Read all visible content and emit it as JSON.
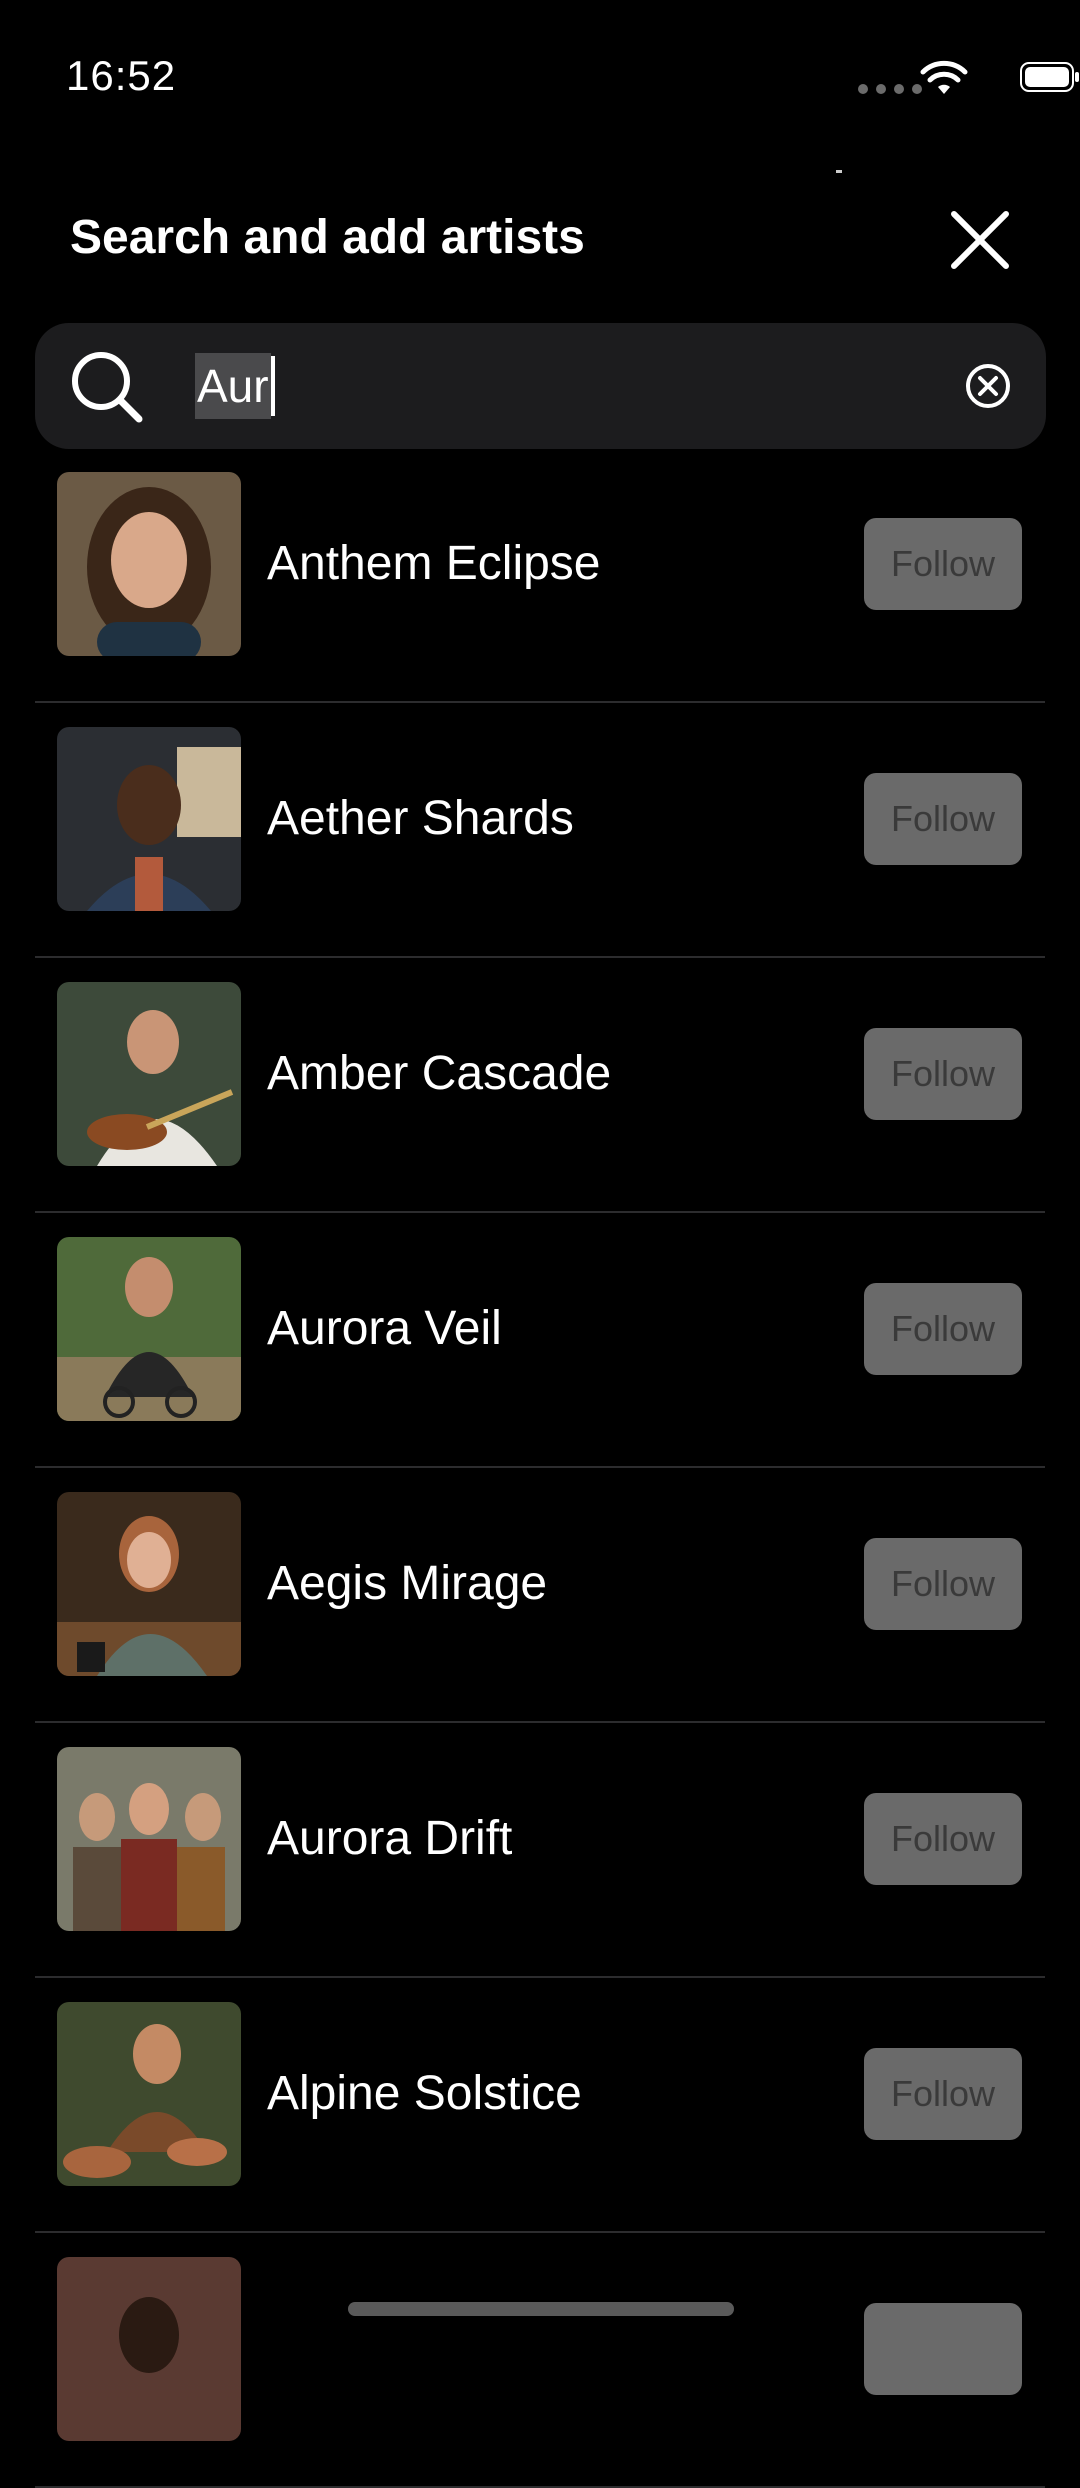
{
  "status_bar": {
    "time": "16:52",
    "wifi_icon": "wifi-icon",
    "battery_icon": "battery-icon"
  },
  "header": {
    "title": "Search and add artists",
    "close_icon": "close-icon"
  },
  "search": {
    "query": "Aur",
    "search_icon": "search-icon",
    "clear_icon": "clear-circle-icon"
  },
  "colors": {
    "background": "#000000",
    "search_background": "#1c1c1e",
    "follow_button_bg": "#6a6a6a",
    "follow_button_text": "#3a3a3a",
    "divider": "#2c2c2e"
  },
  "artists": [
    {
      "name": "Anthem Eclipse",
      "follow_label": "Follow",
      "avatar": "artist-photo"
    },
    {
      "name": "Aether Shards",
      "follow_label": "Follow",
      "avatar": "artist-photo"
    },
    {
      "name": "Amber Cascade",
      "follow_label": "Follow",
      "avatar": "artist-photo"
    },
    {
      "name": "Aurora Veil",
      "follow_label": "Follow",
      "avatar": "artist-photo"
    },
    {
      "name": "Aegis Mirage",
      "follow_label": "Follow",
      "avatar": "artist-photo"
    },
    {
      "name": "Aurora Drift",
      "follow_label": "Follow",
      "avatar": "artist-photo"
    },
    {
      "name": "Alpine Solstice",
      "follow_label": "Follow",
      "avatar": "artist-photo"
    },
    {
      "name": "",
      "follow_label": "",
      "avatar": "artist-photo"
    }
  ]
}
